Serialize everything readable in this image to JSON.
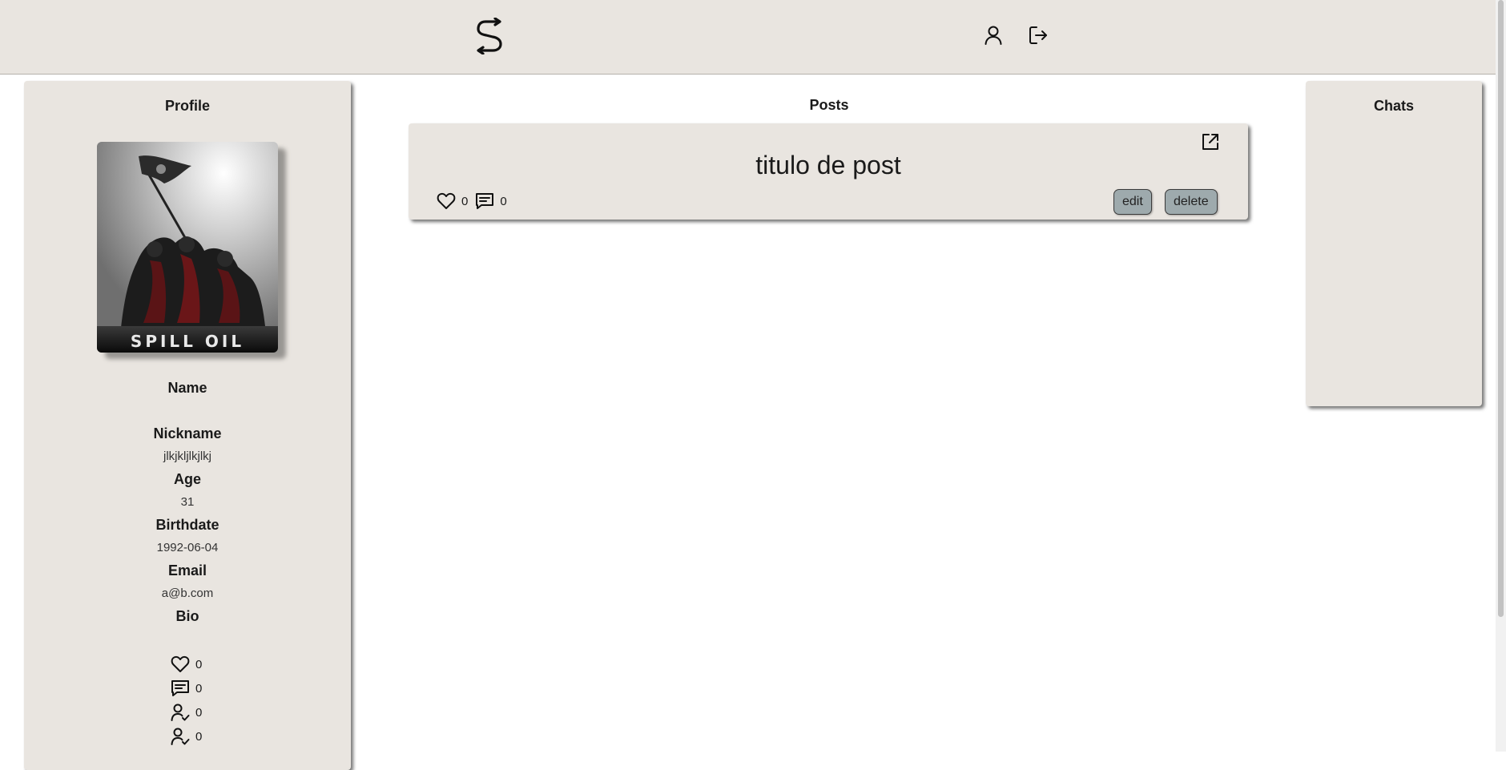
{
  "header": {
    "logo_icon": "swap-s-logo-icon",
    "profile_icon": "user-icon",
    "logout_icon": "logout-icon"
  },
  "profile": {
    "title": "Profile",
    "avatar_caption": "SPILL OIL",
    "name_label": "Name",
    "nickname_label": "Nickname",
    "nickname_value": "jlkjkljlkjlkj",
    "age_label": "Age",
    "age_value": "31",
    "birthdate_label": "Birthdate",
    "birthdate_value": "1992-06-04",
    "email_label": "Email",
    "email_value": "a@b.com",
    "bio_label": "Bio",
    "stats": {
      "likes": "0",
      "comments": "0",
      "followers": "0",
      "following": "0"
    }
  },
  "posts": {
    "title": "Posts",
    "items": [
      {
        "title": "titulo de post",
        "likes": "0",
        "comments": "0",
        "edit_label": "edit",
        "delete_label": "delete"
      }
    ]
  },
  "chats": {
    "title": "Chats"
  },
  "colors": {
    "panel_bg": "#e9e5e0",
    "button_bg": "#9eaaad"
  }
}
